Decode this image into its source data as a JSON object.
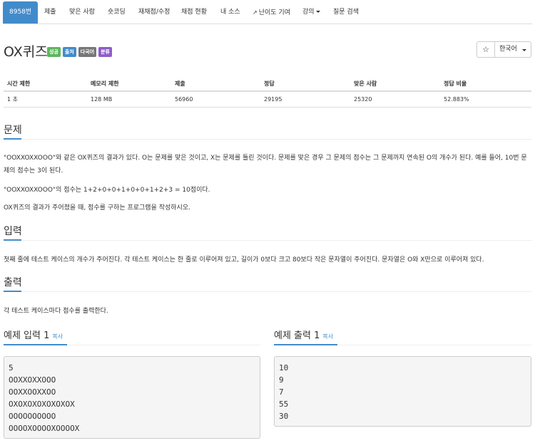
{
  "nav": {
    "items": [
      {
        "label": "8958번",
        "active": true
      },
      {
        "label": "제출"
      },
      {
        "label": "맞은 사람"
      },
      {
        "label": "숏코딩"
      },
      {
        "label": "재채점/수정"
      },
      {
        "label": "채점 현황"
      },
      {
        "label": "내 소스"
      },
      {
        "label": "난이도 기여",
        "icon": "external-link-icon"
      },
      {
        "label": "강의",
        "dropdown": true
      },
      {
        "label": "질문 검색"
      }
    ]
  },
  "problem": {
    "title": "OX퀴즈",
    "labels": [
      "성공",
      "출처",
      "다국어",
      "분류"
    ],
    "star": "☆",
    "language": "한국어"
  },
  "info": {
    "headers": [
      "시간 제한",
      "메모리 제한",
      "제출",
      "정답",
      "맞은 사람",
      "정답 비율"
    ],
    "values": [
      "1 초",
      "128 MB",
      "56960",
      "29195",
      "25320",
      "52.883%"
    ]
  },
  "sections": {
    "problem_heading": "문제",
    "problem_text": [
      "\"OOXXOXXOOO\"와 같은 OX퀴즈의 결과가 있다. O는 문제를 맞은 것이고, X는 문제를 틀린 것이다. 문제를 맞은 경우 그 문제의 점수는 그 문제까지 연속된 O의 개수가 된다. 예를 들어, 10번 문제의 점수는 3이 된다.",
      "\"OOXXOXXOOO\"의 점수는 1+2+0+0+1+0+0+1+2+3 = 10점이다.",
      "OX퀴즈의 결과가 주어졌을 때, 점수를 구하는 프로그램을 작성하시오."
    ],
    "input_heading": "입력",
    "input_text": "첫째 줄에 테스트 케이스의 개수가 주어진다. 각 테스트 케이스는 한 줄로 이루어져 있고, 길이가 0보다 크고 80보다 작은 문자열이 주어진다. 문자열은 O와 X만으로 이루어져 있다.",
    "output_heading": "출력",
    "output_text": "각 테스트 케이스마다 점수를 출력한다."
  },
  "samples": {
    "input_heading": "예제 입력 1",
    "output_heading": "예제 출력 1",
    "copy_label": "복사",
    "input": "5\nOOXXOXXOOO\nOOXXOOXXOO\nOXOXOXOXOXOXOX\nOOOOOOOOOO\nOOOOXOOOOXOOOOX",
    "output": "10\n9\n7\n55\n30"
  }
}
